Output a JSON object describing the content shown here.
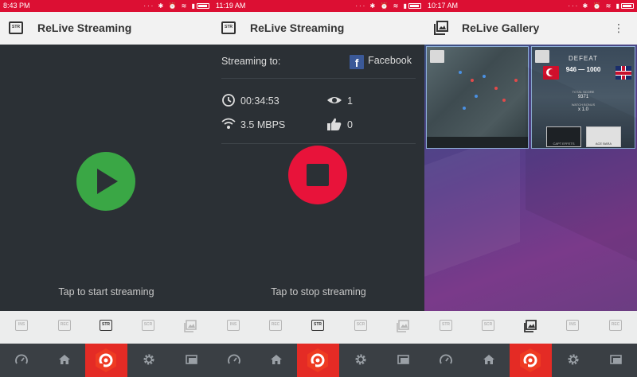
{
  "panel1": {
    "status": {
      "time": "8:43 PM"
    },
    "title": "ReLive Streaming",
    "title_icon_label": "STR",
    "prompt": "Tap to start streaming"
  },
  "panel2": {
    "status": {
      "time": "11:19 AM"
    },
    "title": "ReLive Streaming",
    "title_icon_label": "STR",
    "streaming_to_label": "Streaming to:",
    "platform_name": "Facebook",
    "platform_logo_letter": "f",
    "duration": "00:34:53",
    "bitrate": "3.5 MBPS",
    "viewers": "1",
    "likes": "0",
    "prompt": "Tap to stop streaming"
  },
  "panel3": {
    "status": {
      "time": "10:17 AM"
    },
    "title": "ReLive Gallery",
    "menu_icon": "overflow-menu-icon",
    "thumb2": {
      "result": "DEFEAT",
      "score": "946 — 1000",
      "total_score_label": "TOTAL SCORE",
      "total_score": "9371",
      "bonus_label": "WATCH BONUS",
      "bonus": "x 1.0",
      "card1": "CAPT EFFETS",
      "card2": "ACE BARA"
    }
  },
  "subtabs": {
    "panel1": [
      "INS",
      "REC",
      "STR",
      "SCR",
      "gallery-icon"
    ],
    "panel2": [
      "INS",
      "REC",
      "STR",
      "SCR",
      "gallery-icon"
    ],
    "panel3": [
      "STR",
      "SCR",
      "gallery-icon",
      "INS",
      "REC"
    ]
  },
  "nav_icons": [
    "speedometer-icon",
    "home-icon",
    "relive-logo-icon",
    "gear-icon",
    "overlay-icon"
  ],
  "colors": {
    "status_red": "#dc0f33",
    "play_green": "#3aa745",
    "stop_red": "#e8133a",
    "nav_bg": "#3a3f44",
    "nav_active": "#e42b25",
    "facebook_blue": "#3b5998"
  }
}
